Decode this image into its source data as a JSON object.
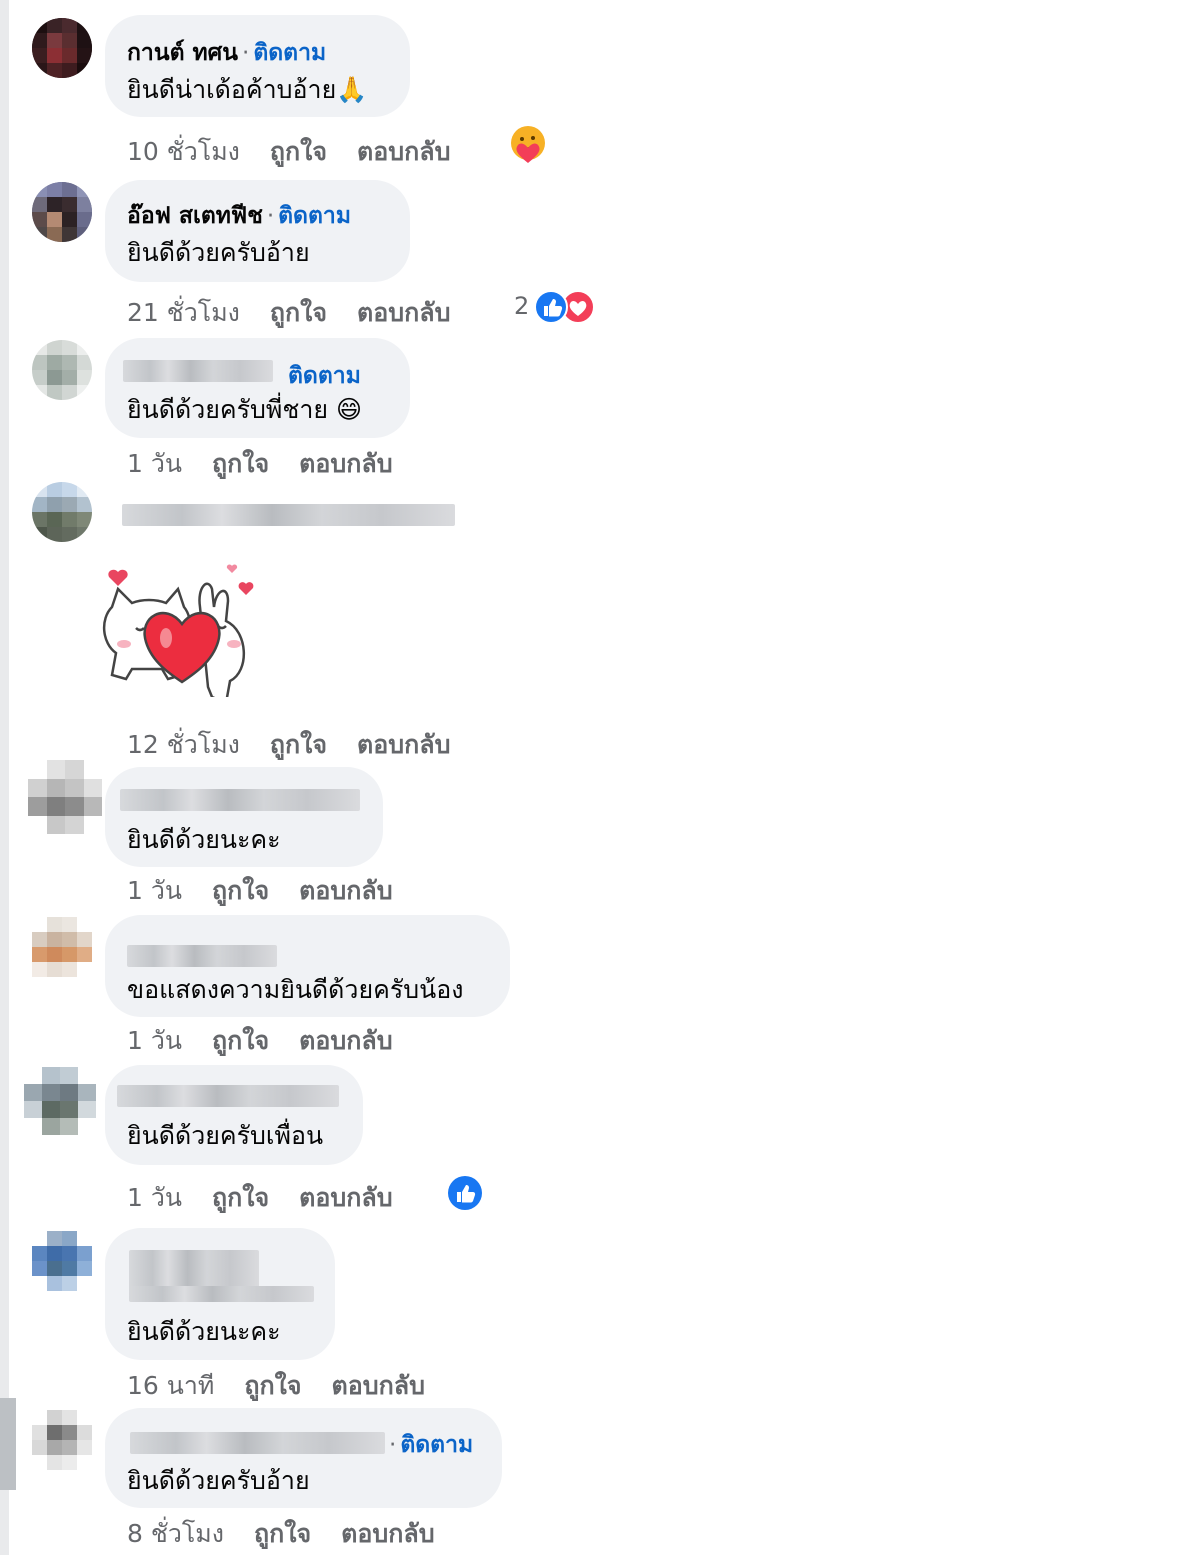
{
  "ui": {
    "follow_label": "ติดตาม",
    "like_label": "ถูกใจ",
    "reply_label": "ตอบกลับ",
    "dot": "·"
  },
  "comments": [
    {
      "name": "กานต์ ทศน",
      "text": "ยินดีน่าเด้อค้าบอ้าย🙏",
      "time": "10 ชั่วโมง",
      "reaction": "care-emoji"
    },
    {
      "name": "อ๊อฟ สเตทฟีช",
      "text": "ยินดีด้วยครับอ้าย",
      "time": "21 ชั่วโมง",
      "reaction_count": "2",
      "reaction": "like-love"
    },
    {
      "name": "",
      "text": "ยินดีด้วยครับพี่ชาย 😄",
      "time": "1 วัน"
    },
    {
      "name": "",
      "text": "",
      "time": "12 ชั่วโมง",
      "sticker": "cat-bunny-heart-sticker"
    },
    {
      "name": "",
      "text": "ยินดีด้วยนะคะ",
      "time": "1 วัน"
    },
    {
      "name": "",
      "text": "ขอแสดงความยินดีด้วยครับน้อง",
      "time": "1 วัน"
    },
    {
      "name": "",
      "text": "ยินดีด้วยครับเพื่อน",
      "time": "1 วัน",
      "reaction": "like"
    },
    {
      "name": "",
      "text": "ยินดีด้วยนะคะ",
      "time": "16 นาที"
    },
    {
      "name": "",
      "text": "ยินดีด้วยครับอ้าย",
      "time": "8 ชั่วโมง"
    }
  ],
  "colors": {
    "bubble": "#f0f2f5",
    "follow": "#0b64c8",
    "meta": "#65676b",
    "like": "#1877f2",
    "love": "#f33e58"
  }
}
